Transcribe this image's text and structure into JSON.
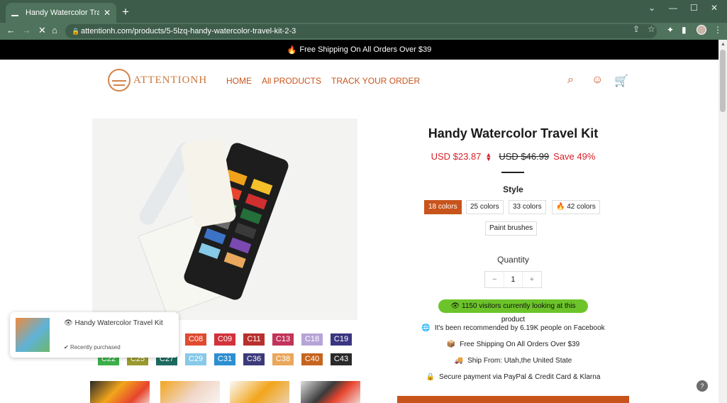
{
  "browser": {
    "tab_title": "Handy Watercolor Travel Kit - att",
    "tab_close": "✕",
    "new_tab": "+",
    "url": "attentionh.com/products/5-5lzq-handy-watercolor-travel-kit-2-3",
    "icons": [
      "back-icon",
      "forward-icon",
      "stop-loading-icon",
      "home-icon",
      "lock-icon",
      "share-icon",
      "bookmark-star-icon",
      "extensions-icon",
      "side-panel-icon",
      "profile-avatar",
      "menu-dots-icon"
    ]
  },
  "announcement": "Free Shipping On All Orders Over $39",
  "brand": {
    "name": "ATTENTIONH",
    "accent": "#c8541c"
  },
  "nav": [
    "HOME",
    "All PRODUCTS",
    "TRACK YOUR ORDER"
  ],
  "product": {
    "title": "Handy Watercolor Travel Kit",
    "price_now": "USD $23.87",
    "price_was": "USD $46.99",
    "save": "Save 49%",
    "style_label": "Style",
    "styles": [
      "18 colors",
      "25 colors",
      "33 colors",
      "42 colors",
      "Paint brushes"
    ],
    "selected_style": "18 colors",
    "quantity_label": "Quantity",
    "quantity": "1",
    "qty_minus": "−",
    "qty_plus": "+",
    "visitors": "1150 visitors currently looking at this product",
    "features": [
      "It's been recommended by 6.19K people on Facebook",
      "Free Shipping On All Orders Over $39",
      "Ship From: Utah,the United State",
      "Secure payment via PayPal & Credit Card & Klarna"
    ]
  },
  "gallery": {
    "color_chips_row1": [
      {
        "code": "C08",
        "color": "#e04a2f"
      },
      {
        "code": "C09",
        "color": "#d2323a"
      },
      {
        "code": "C11",
        "color": "#b8302e"
      },
      {
        "code": "C13",
        "color": "#c2335a"
      },
      {
        "code": "C18",
        "color": "#b6a4d6"
      },
      {
        "code": "C19",
        "color": "#3a3580"
      }
    ],
    "color_chips_row2": [
      {
        "code": "C22",
        "color": "#3bb04a"
      },
      {
        "code": "C25",
        "color": "#9a9a2e"
      },
      {
        "code": "C27",
        "color": "#1d6b60"
      },
      {
        "code": "C29",
        "color": "#86c9e8"
      },
      {
        "code": "C31",
        "color": "#2c8fd0"
      },
      {
        "code": "C36",
        "color": "#3c3a7a"
      },
      {
        "code": "C38",
        "color": "#e9a85c"
      },
      {
        "code": "C40",
        "color": "#c6651f"
      },
      {
        "code": "C43",
        "color": "#2a2a2a"
      }
    ]
  },
  "popup": {
    "title": "Handy Watercolor Travel Kit",
    "status": "Recently purchased"
  }
}
